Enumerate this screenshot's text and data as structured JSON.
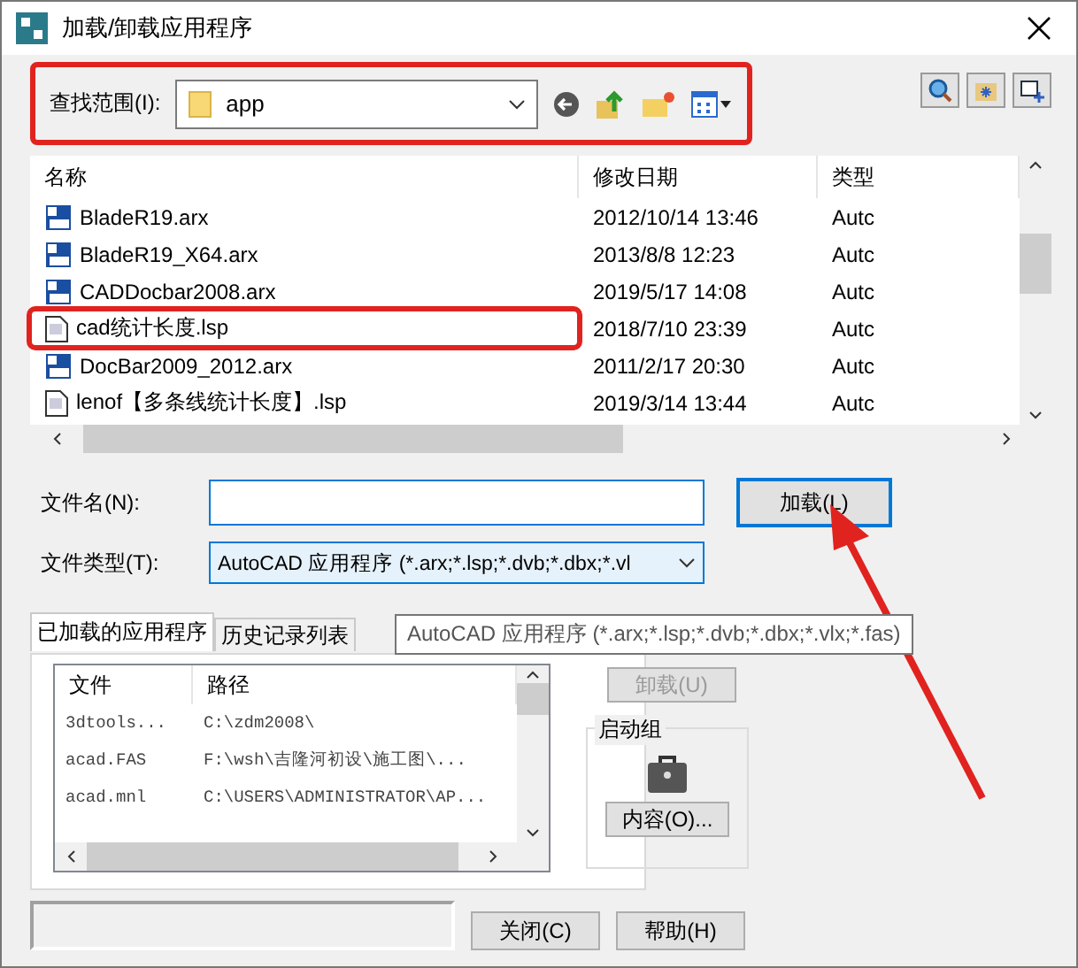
{
  "window": {
    "title": "加载/卸载应用程序"
  },
  "look_in": {
    "label": "查找范围(I):",
    "value": "app"
  },
  "file_list": {
    "columns": [
      "名称",
      "修改日期",
      "类型"
    ],
    "rows": [
      {
        "kind": "arx",
        "name": "BladeR19.arx",
        "date": "2012/10/14 13:46",
        "type": "Autc",
        "highlighted": false
      },
      {
        "kind": "arx",
        "name": "BladeR19_X64.arx",
        "date": "2013/8/8 12:23",
        "type": "Autc",
        "highlighted": false
      },
      {
        "kind": "arx",
        "name": "CADDocbar2008.arx",
        "date": "2019/5/17 14:08",
        "type": "Autc",
        "highlighted": false
      },
      {
        "kind": "lsp",
        "name": "cad统计长度.lsp",
        "date": "2018/7/10 23:39",
        "type": "Autc",
        "highlighted": true
      },
      {
        "kind": "arx",
        "name": "DocBar2009_2012.arx",
        "date": "2011/2/17 20:30",
        "type": "Autc",
        "highlighted": false
      },
      {
        "kind": "lsp",
        "name": "lenof【多条线统计长度】.lsp",
        "date": "2019/3/14 13:44",
        "type": "Autc",
        "highlighted": false
      }
    ]
  },
  "file_name": {
    "label": "文件名(N):"
  },
  "file_type": {
    "label": "文件类型(T):",
    "value": "AutoCAD 应用程序 (*.arx;*.lsp;*.dvb;*.dbx;*.vl"
  },
  "load_button": "加载(L)",
  "tabs": [
    {
      "label": "已加载的应用程序",
      "selected": true
    },
    {
      "label": "历史记录列表",
      "selected": false
    }
  ],
  "tooltip": "AutoCAD 应用程序 (*.arx;*.lsp;*.dvb;*.dbx;*.vlx;*.fas)",
  "loaded_list": {
    "columns": [
      "文件",
      "路径"
    ],
    "rows": [
      {
        "file": "3dtools...",
        "path": "C:\\zdm2008\\"
      },
      {
        "file": "acad.FAS",
        "path": "F:\\wsh\\吉隆河初设\\施工图\\..."
      },
      {
        "file": "acad.mnl",
        "path": "C:\\USERS\\ADMINISTRATOR\\AP..."
      }
    ]
  },
  "unload_button": {
    "label": "卸载(U)",
    "disabled": true
  },
  "startup_group": {
    "title": "启动组",
    "button": "内容(O)..."
  },
  "close_button": "关闭(C)",
  "help_button": "帮助(H)"
}
